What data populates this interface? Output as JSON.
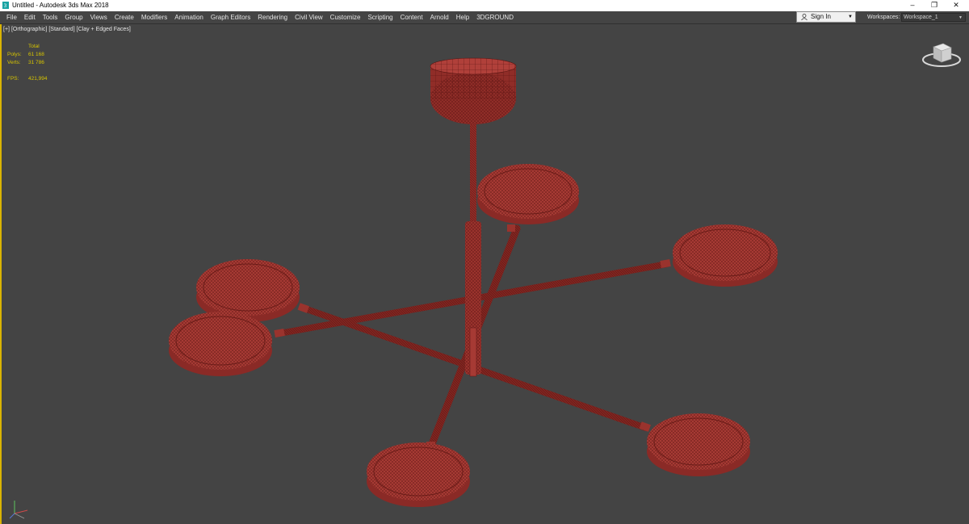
{
  "window": {
    "title": "Untitled - Autodesk 3ds Max 2018",
    "minimize": "–",
    "restore": "❐",
    "close": "✕"
  },
  "menu": [
    "File",
    "Edit",
    "Tools",
    "Group",
    "Views",
    "Create",
    "Modifiers",
    "Animation",
    "Graph Editors",
    "Rendering",
    "Civil View",
    "Customize",
    "Scripting",
    "Content",
    "Arnold",
    "Help",
    "3DGROUND"
  ],
  "signin": {
    "label": "Sign In",
    "dropdown_glyph": "▼"
  },
  "workspaces": {
    "label": "Workspaces:",
    "value": "Workspace_1",
    "dropdown_glyph": "▼"
  },
  "viewport": {
    "labels": [
      "[+]",
      "[Orthographic]",
      "[Standard]",
      "[Clay + Edged Faces]"
    ],
    "stats": {
      "header": "Total",
      "polys_label": "Polys:",
      "polys_value": "61 168",
      "verts_label": "Verts:",
      "verts_value": "31 786",
      "fps_label": "FPS:",
      "fps_value": "421,994"
    },
    "model_color": "#a63a34",
    "wire_color": "#5a1412",
    "accent_border": "#d9b300"
  },
  "icons": {
    "app": "3dsmax-icon",
    "user": "user-icon",
    "viewcube": "viewcube-icon",
    "axis": "axis-tripod-icon"
  }
}
